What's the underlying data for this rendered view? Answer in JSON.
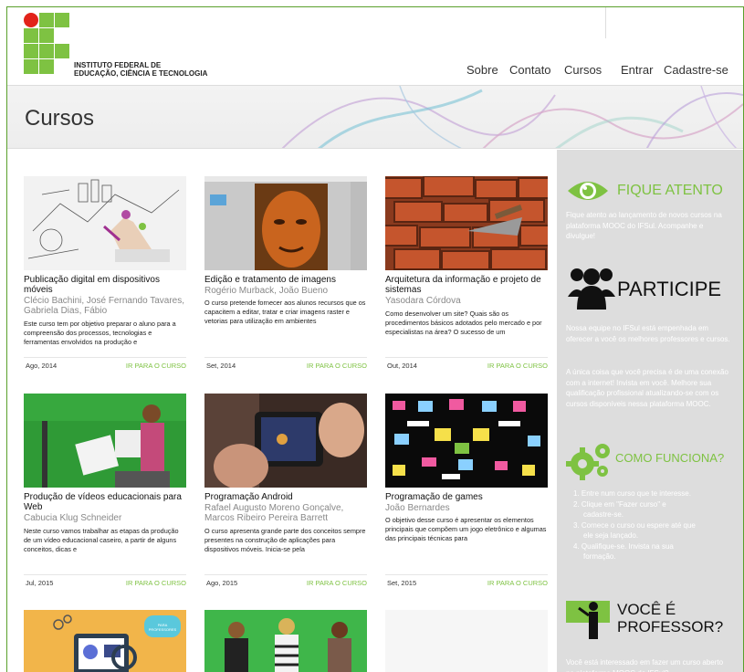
{
  "header": {
    "institute_line1": "INSTITUTO FEDERAL DE",
    "institute_line2": "EDUCAÇÃO, CIÊNCIA E TECNOLOGIA",
    "nav": [
      "Sobre",
      "Contato",
      "Cursos",
      "Entrar",
      "Cadastre-se"
    ]
  },
  "banner": {
    "title": "Cursos"
  },
  "courses": [
    {
      "title": "Publicação digital em dispositivos móveis",
      "authors": "Clécio Bachini, José Fernando Tavares, Gabriela Dias, Fábio",
      "desc": "Este curso tem por objetivo preparar o aluno para a compreensão dos processos, tecnologias e ferramentas envolvidos na produção e",
      "date": "Ago, 2014",
      "link": "IR PARA O CURSO",
      "thumb": "sketch-hand"
    },
    {
      "title": "Edição e tratamento de imagens",
      "authors": "Rogério Murback, João Bueno",
      "desc": "O curso pretende fornecer aos alunos recursos que os capacitem a editar, tratar e criar imagens raster e vetorias para utilização em ambientes",
      "date": "Set, 2014",
      "link": "IR PARA O CURSO",
      "thumb": "face-editor"
    },
    {
      "title": "Arquitetura da informação e projeto de sistemas",
      "authors": "Yasodara Córdova",
      "desc": "Como desenvolver um site? Quais são os procedimentos básicos adotados pelo mercado e por especialistas na área? O sucesso de um",
      "date": "Out, 2014",
      "link": "IR PARA O CURSO",
      "thumb": "bricks"
    },
    {
      "title": "Produção de vídeos educacionais para Web",
      "authors": "Cabucia Klug Schneider",
      "desc": "Neste curso vamos trabalhar as etapas da produção de um vídeo educacional caseiro, a partir de alguns conceitos, dicas e",
      "date": "Jul, 2015",
      "link": "IR PARA O CURSO",
      "thumb": "greenscreen"
    },
    {
      "title": "Programação Android",
      "authors": "Rafael Augusto Moreno Gonçalve, Marcos Ribeiro Pereira Barrett",
      "desc": "O curso apresenta grande parte dos conceitos sempre presentes na construção de aplicações para dispositivos móveis. Inicia-se pela",
      "date": "Ago, 2015",
      "link": "IR PARA O CURSO",
      "thumb": "phone"
    },
    {
      "title": "Programação de games",
      "authors": "João Bernardes",
      "desc": "O objetivo desse curso é apresentar os elementos principais que compõem um jogo eletrônico e algumas das principais técnicas para",
      "date": "Set, 2015",
      "link": "IR PARA O CURSO",
      "thumb": "invaders"
    }
  ],
  "row3": {
    "badge_text": "PARA PROFESSORES"
  },
  "sidebar": {
    "fique_title": "FIQUE ATENTO",
    "fique_text": "Fique atento ao lançamento de novos cursos na plataforma MOOC do IFSul. Acompanhe e divulgue!",
    "participe_title": "PARTICIPE",
    "participe_text1": "Nossa equipe no IFSul está empenhada em oferecer a você os melhores professores e cursos.",
    "participe_text2": "A única coisa que você precisa é de uma conexão com a internet! Invista em você. Melhore sua qualificação profissional atualizando-se com os cursos disponíveis nessa plataforma MOOC.",
    "como_title": "COMO FUNCIONA?",
    "como_steps": [
      "1. Entre num curso que te interesse.",
      "2. Clique em \"Fazer curso\" e",
      "cadastre-se.",
      "3. Comece o curso ou espere até que",
      "ele seja lançado.",
      "4. Qualifique-se. Invista na sua",
      "formação."
    ],
    "voce_title1": "VOCÊ É",
    "voce_title2": "PROFESSOR?",
    "voce_text": "Você está interessado em fazer um curso aberto na plataforma MOOC do IFSul?"
  },
  "colors": {
    "accent": "#7ec242",
    "logo_red": "#e2231a",
    "sidebar_bg": "#dddddd"
  }
}
